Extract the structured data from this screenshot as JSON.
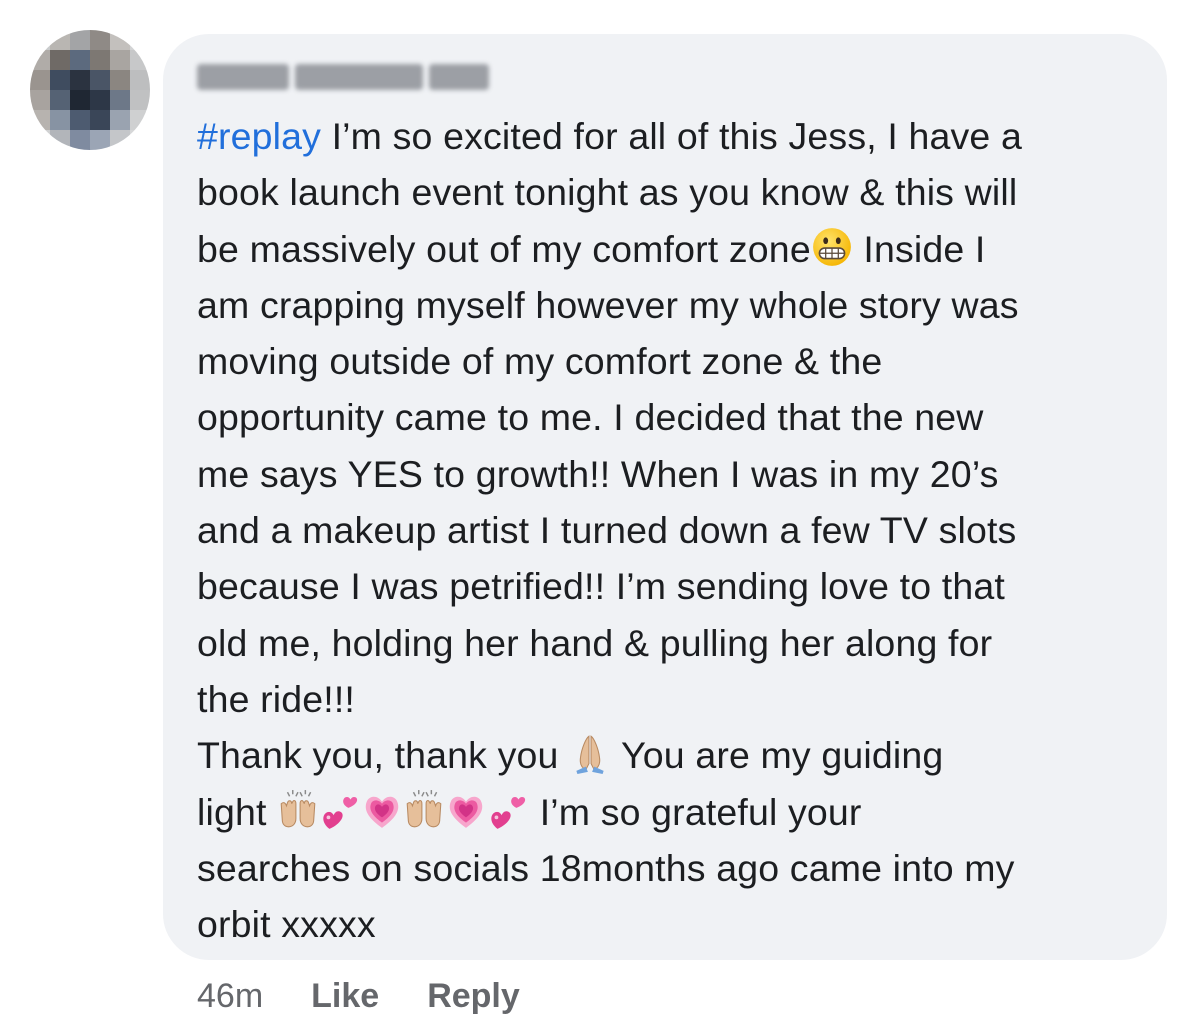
{
  "comment": {
    "hashtag": "#replay",
    "lines": [
      " I’m so excited for all of this Jess, I have a",
      "book launch event tonight as you know & this will",
      "be massively out of my comfort zone",
      " Inside I",
      "am crapping myself however my whole story was",
      "moving outside of my comfort zone & the",
      "opportunity came to me. I decided that the new",
      "me says YES to growth!! When I was in my 20’s",
      "and a makeup artist I turned down a few TV slots",
      "because I was petrified!! I’m sending love to that",
      "old me, holding her hand & pulling her along for",
      "the ride!!!",
      "Thank you, thank you ",
      " You are my guiding",
      "light ",
      " I’m so grateful your",
      "searches on socials 18months ago came into my",
      "orbit xxxxx"
    ],
    "emojis": {
      "grimace": "grimacing-face-icon",
      "pray": "folded-hands-icon",
      "raise": "raising-hands-icon",
      "two_hearts": "two-hearts-icon",
      "growing_heart": "growing-heart-icon"
    }
  },
  "actions": {
    "timestamp": "46m",
    "like_label": "Like",
    "reply_label": "Reply"
  },
  "colors": {
    "bubble": "#f0f2f5",
    "hashtag": "#216fdb",
    "text": "#1c1e21",
    "muted": "#65676b"
  }
}
